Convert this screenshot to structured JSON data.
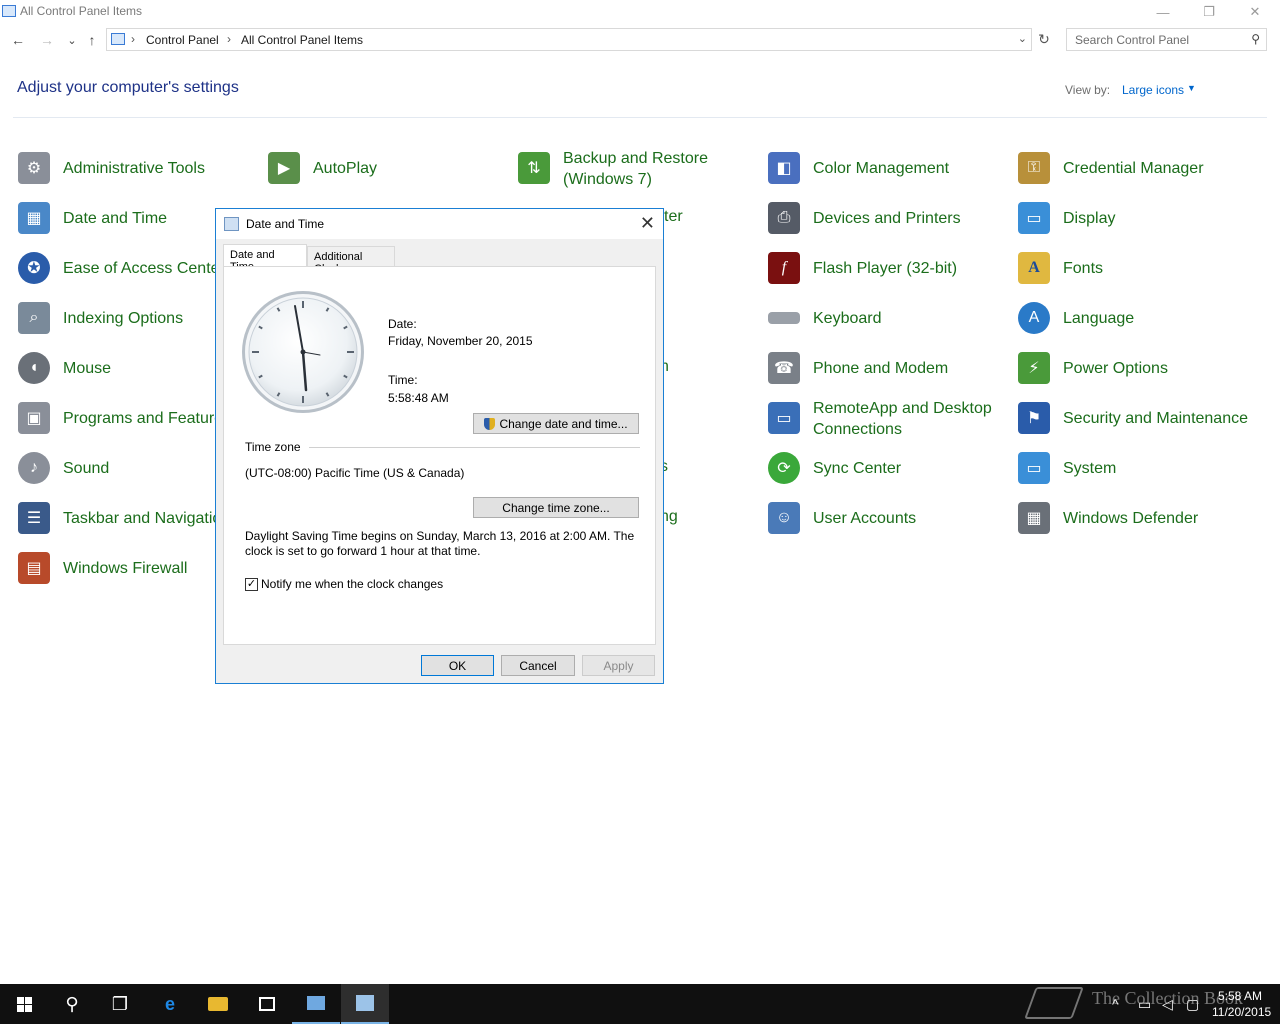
{
  "window": {
    "title": "All Control Panel Items",
    "buttons": {
      "minimize": "—",
      "restore": "❐",
      "close": "✕"
    }
  },
  "nav": {
    "back": "←",
    "forward": "→",
    "recent": "⌄",
    "up": "↑",
    "breadcrumb": [
      "Control Panel",
      "All Control Panel Items"
    ],
    "separator": "›",
    "chevron": "⌄",
    "refresh": "↻",
    "search_placeholder": "Search Control Panel",
    "search_icon": "⚲"
  },
  "header": {
    "title": "Adjust your computer's settings",
    "view_by_label": "View by:",
    "view_by_value": "Large icons",
    "view_by_arrow": "▼"
  },
  "items": {
    "administrative_tools": {
      "label": "Administrative Tools",
      "icon": "tools-icon",
      "color": "#8a8f99"
    },
    "autoplay": {
      "label": "AutoPlay",
      "icon": "autoplay-icon",
      "color": "#5a8f4a"
    },
    "backup_restore": {
      "label_line1": "Backup and Restore",
      "label_line2": "(Windows 7)",
      "icon": "backup-icon",
      "color": "#4a9a3a"
    },
    "color_management": {
      "label": "Color Management",
      "icon": "color-management-icon",
      "color": "#4a6fbf"
    },
    "credential_manager": {
      "label": "Credential Manager",
      "icon": "vault-icon",
      "color": "#b8903a"
    },
    "date_time": {
      "label": "Date and Time",
      "icon": "calendar-clock-icon",
      "color": "#4a88c8"
    },
    "devices_printers": {
      "label": "Devices and Printers",
      "icon": "printer-icon",
      "color": "#555b66"
    },
    "display": {
      "label": "Display",
      "icon": "monitor-icon",
      "color": "#3a8fd8"
    },
    "ease_of_access": {
      "label": "Ease of Access Center",
      "icon": "ease-of-access-icon",
      "color": "#2a5caa"
    },
    "flash_player": {
      "label": "Flash Player (32-bit)",
      "icon": "flash-icon",
      "color": "#7a1010"
    },
    "fonts": {
      "label": "Fonts",
      "icon": "font-folder-icon",
      "color": "#e0b840"
    },
    "indexing_options": {
      "label": "Indexing Options",
      "icon": "indexing-icon",
      "color": "#7a8a9a"
    },
    "keyboard": {
      "label": "Keyboard",
      "icon": "keyboard-icon",
      "color": "#9aa0a8"
    },
    "language": {
      "label": "Language",
      "icon": "language-icon",
      "color": "#2a7ac8"
    },
    "mouse": {
      "label": "Mouse",
      "icon": "mouse-icon",
      "color": "#6a7078"
    },
    "phone_modem": {
      "label": "Phone and Modem",
      "icon": "phone-icon",
      "color": "#7a8088"
    },
    "power_options": {
      "label": "Power Options",
      "icon": "battery-icon",
      "color": "#4a9a3a"
    },
    "programs_features": {
      "label": "Programs and Features",
      "icon": "programs-icon",
      "color": "#8a8f99"
    },
    "remoteapp": {
      "label_line1": "RemoteApp and Desktop",
      "label_line2": "Connections",
      "icon": "remote-desktop-icon",
      "color": "#3a6fb8"
    },
    "security_maintenance": {
      "label": "Security and Maintenance",
      "icon": "flag-icon",
      "color": "#2a5caa"
    },
    "sound": {
      "label": "Sound",
      "icon": "speaker-icon",
      "color": "#8a8f99"
    },
    "sync_center": {
      "label": "Sync Center",
      "icon": "sync-icon",
      "color": "#3aa83a"
    },
    "system": {
      "label": "System",
      "icon": "computer-icon",
      "color": "#3a8fd8"
    },
    "taskbar_navigation": {
      "label": "Taskbar and Navigation",
      "icon": "taskbar-icon",
      "color": "#3a5a8a"
    },
    "user_accounts": {
      "label": "User Accounts",
      "icon": "users-icon",
      "color": "#4a7ab8"
    },
    "windows_defender": {
      "label": "Windows Defender",
      "icon": "defender-icon",
      "color": "#6a7078"
    },
    "windows_firewall": {
      "label": "Windows Firewall",
      "icon": "firewall-icon",
      "color": "#b84a2a"
    },
    "partial_ter": {
      "label": "ter"
    },
    "partial_n": {
      "label": "n"
    },
    "partial_s": {
      "label": "s"
    },
    "partial_ng": {
      "label": "ng"
    }
  },
  "dialog": {
    "title": "Date and Time",
    "close": "✕",
    "tabs": [
      "Date and Time",
      "Additional Clocks"
    ],
    "date_label": "Date:",
    "date_value": "Friday, November 20, 2015",
    "time_label": "Time:",
    "time_value": "5:58:48 AM",
    "change_datetime_button": "Change date and time...",
    "timezone_heading": "Time zone",
    "timezone_value": "(UTC-08:00) Pacific Time (US & Canada)",
    "change_timezone_button": "Change time zone...",
    "dst_notice": "Daylight Saving Time begins on Sunday, March 13, 2016 at 2:00 AM. The clock is set to go forward 1 hour at that time.",
    "notify_checked": true,
    "notify_label": "Notify me when the clock changes",
    "ok": "OK",
    "cancel": "Cancel",
    "apply": "Apply"
  },
  "taskbar": {
    "start_icon": "windows-logo-icon",
    "search_icon": "search-icon",
    "task_view_icon": "task-view-icon",
    "edge_icon": "edge-icon",
    "explorer_icon": "folder-icon",
    "store_icon": "store-icon",
    "time": "5:58 AM",
    "date": "11/20/2015",
    "watermark": "The Collection Book"
  }
}
